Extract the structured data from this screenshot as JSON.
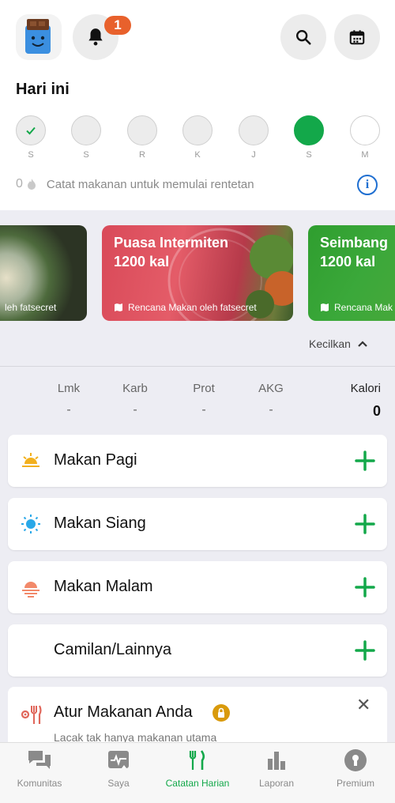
{
  "header": {
    "notification_count": "1"
  },
  "today_label": "Hari ini",
  "week_days": [
    {
      "label": "S",
      "state": "done"
    },
    {
      "label": "S",
      "state": "past"
    },
    {
      "label": "R",
      "state": "past"
    },
    {
      "label": "K",
      "state": "past"
    },
    {
      "label": "J",
      "state": "past"
    },
    {
      "label": "S",
      "state": "today"
    },
    {
      "label": "M",
      "state": "future"
    }
  ],
  "streak": {
    "count": "0",
    "text": "Catat makanan untuk memulai rentetan"
  },
  "plans": [
    {
      "title": "",
      "kcal": "",
      "footer": "leh fatsecret"
    },
    {
      "title": "Puasa Intermiten",
      "kcal": "1200 kal",
      "footer": "Rencana Makan oleh fatsecret"
    },
    {
      "title": "Seimbang",
      "kcal": "1200 kal",
      "footer": "Rencana Mak"
    }
  ],
  "collapse_label": "Kecilkan",
  "nutrition": [
    {
      "label": "Lmk",
      "value": "-"
    },
    {
      "label": "Karb",
      "value": "-"
    },
    {
      "label": "Prot",
      "value": "-"
    },
    {
      "label": "AKG",
      "value": "-"
    },
    {
      "label": "Kalori",
      "value": "0"
    }
  ],
  "meals": [
    {
      "name": "Makan Pagi",
      "icon": "sunrise-icon"
    },
    {
      "name": "Makan Siang",
      "icon": "sun-icon"
    },
    {
      "name": "Makan Malam",
      "icon": "sunset-icon"
    },
    {
      "name": "Camilan/Lainnya",
      "icon": "moon-icon"
    }
  ],
  "promo": {
    "title": "Atur Makanan Anda",
    "subtitle": "Lacak tak hanya makanan utama"
  },
  "tabs": [
    {
      "label": "Komunitas",
      "icon": "chat-icon"
    },
    {
      "label": "Saya",
      "icon": "profile-icon"
    },
    {
      "label": "Catatan Harian",
      "icon": "utensils-icon",
      "active": true
    },
    {
      "label": "Laporan",
      "icon": "bar-chart-icon"
    },
    {
      "label": "Premium",
      "icon": "premium-icon"
    }
  ],
  "colors": {
    "accent": "#13a84a",
    "badge": "#e8612c",
    "info": "#1f6fd1",
    "premium_lock": "#d99a0b"
  }
}
